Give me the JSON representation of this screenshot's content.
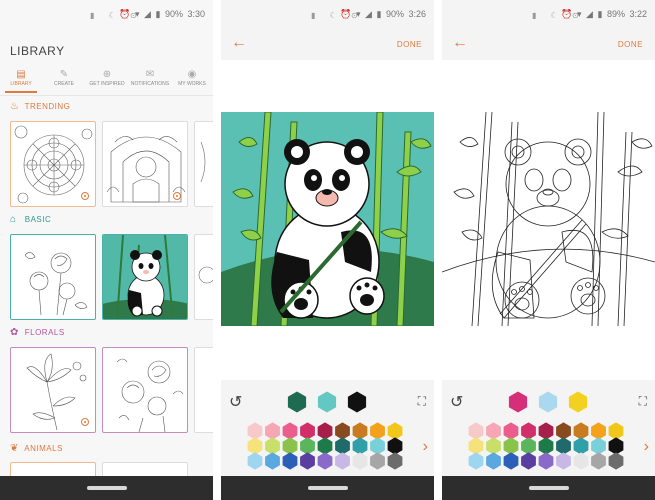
{
  "screens": [
    {
      "status": {
        "time": "3:30",
        "battery": "90%"
      },
      "library": {
        "title": "LIBRARY",
        "tabs": [
          {
            "label": "LIBRARY",
            "icon": "book-icon",
            "active": true
          },
          {
            "label": "CREATE",
            "icon": "pencil-icon",
            "active": false
          },
          {
            "label": "GET INSPIRED",
            "icon": "search-icon",
            "active": false
          },
          {
            "label": "NOTIFICATIONS",
            "icon": "mail-icon",
            "active": false
          },
          {
            "label": "MY WORKS",
            "icon": "palette-icon",
            "active": false
          }
        ],
        "sections": [
          {
            "title": "TRENDING",
            "icon": "flame-icon",
            "color": "#e07a3c"
          },
          {
            "title": "BASIC",
            "icon": "tag-icon",
            "color": "#2a9a8e"
          },
          {
            "title": "FLORALS",
            "icon": "flower-icon",
            "color": "#b0559f"
          },
          {
            "title": "ANIMALS",
            "icon": "paw-icon",
            "color": "#e07a3c"
          }
        ]
      }
    },
    {
      "status": {
        "time": "3:26",
        "battery": "90%"
      },
      "editor": {
        "done_label": "DONE",
        "recent_colors": [
          "#1f6b52",
          "#63c7c3",
          "#111111"
        ]
      }
    },
    {
      "status": {
        "time": "3:22",
        "battery": "89%"
      },
      "editor": {
        "done_label": "DONE",
        "recent_colors": [
          "#d62f7a",
          "#aad8ef",
          "#f3d21f"
        ]
      }
    }
  ],
  "palette": [
    [
      "#f8c9c9",
      "#f7a6b4",
      "#ea5d8c",
      "#d12e6a",
      "#a61f4a",
      "#8a4a1f",
      "#c97c1f",
      "#f4a21c",
      "#f1c71a"
    ],
    [
      "#f6e27a",
      "#c8e06a",
      "#8bc34a",
      "#5bb55c",
      "#1f7a4a",
      "#1e6b6a",
      "#2f9fa8",
      "#7ad0d8",
      "#111111"
    ],
    [
      "#9ed6f0",
      "#5aa8e0",
      "#2c5fb8",
      "#5a3fa0",
      "#8a6ac8",
      "#c7b8e6",
      "#e6e6e6",
      "#a6a6a6",
      "#6c6c6c"
    ]
  ]
}
